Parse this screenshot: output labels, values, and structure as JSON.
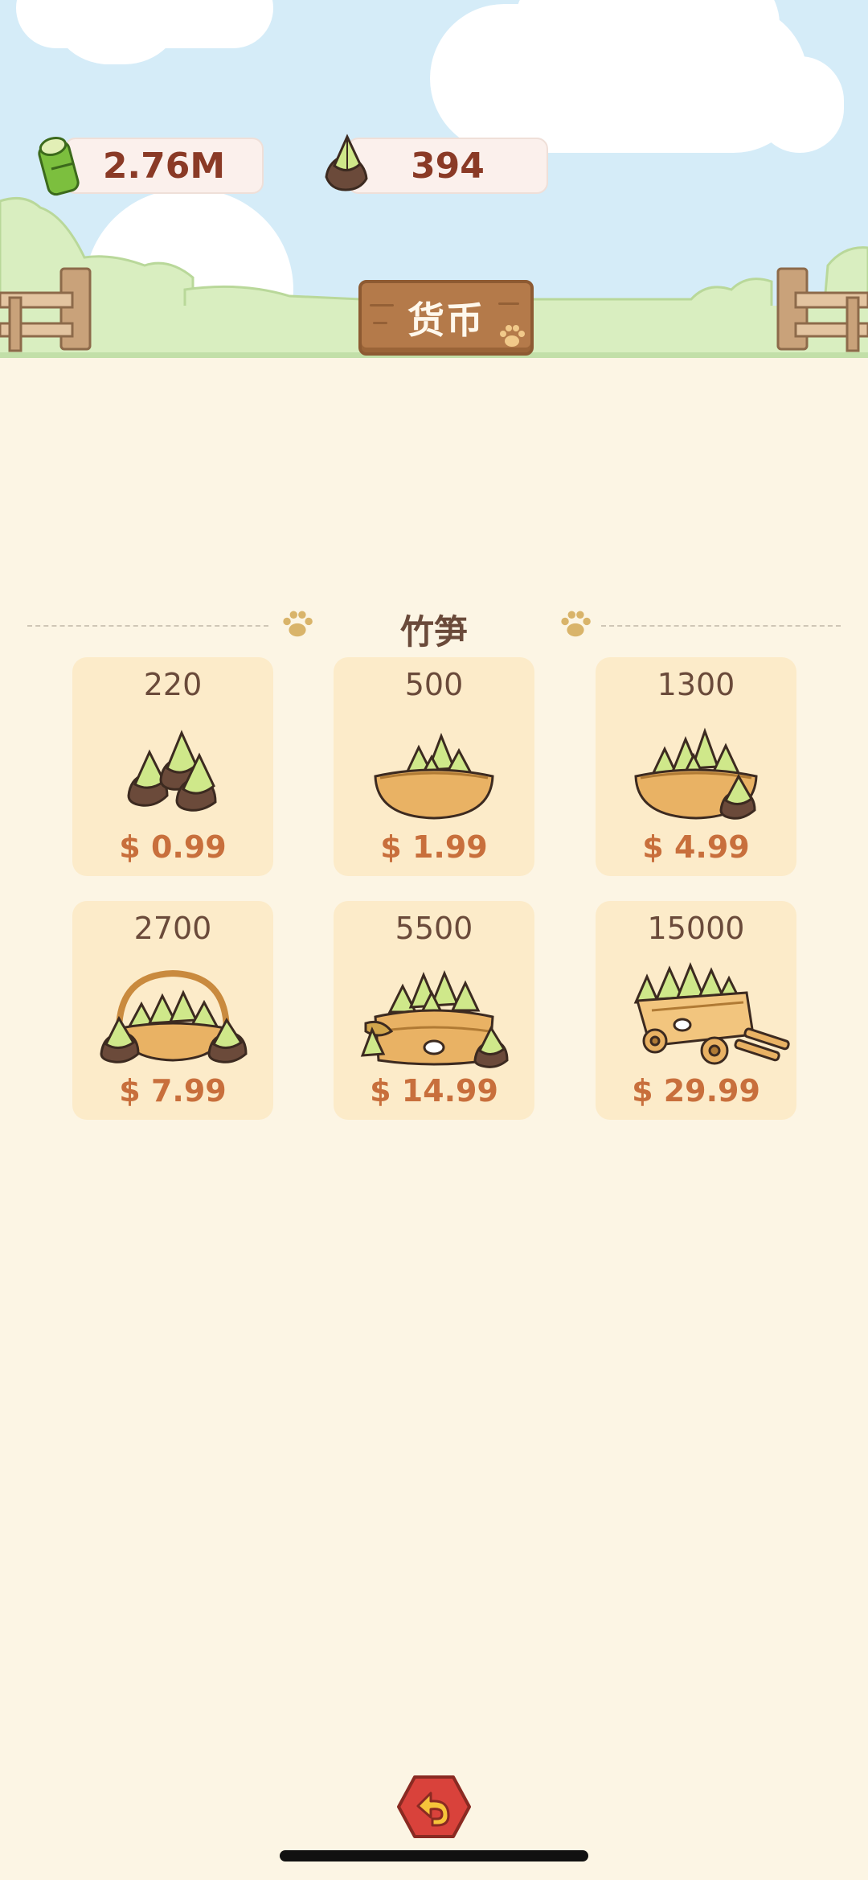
{
  "header": {
    "bamboo_amount": "2.76M",
    "shoot_amount": "394",
    "sign_label": "货币"
  },
  "section": {
    "title": "竹笋"
  },
  "packs": [
    {
      "quantity": "220",
      "price": "$ 0.99",
      "art": "small-pile-icon"
    },
    {
      "quantity": "500",
      "price": "$ 1.99",
      "art": "bowl-icon"
    },
    {
      "quantity": "1300",
      "price": "$ 4.99",
      "art": "full-bowl-icon"
    },
    {
      "quantity": "2700",
      "price": "$ 7.99",
      "art": "basket-icon"
    },
    {
      "quantity": "5500",
      "price": "$ 14.99",
      "art": "steamer-icon"
    },
    {
      "quantity": "15000",
      "price": "$ 29.99",
      "art": "cart-icon"
    }
  ],
  "colors": {
    "background": "#fcf5e4",
    "card": "#fcebc9",
    "price": "#c86f3c",
    "sky": "#d5ecf8",
    "back_button": "#d9423b"
  }
}
